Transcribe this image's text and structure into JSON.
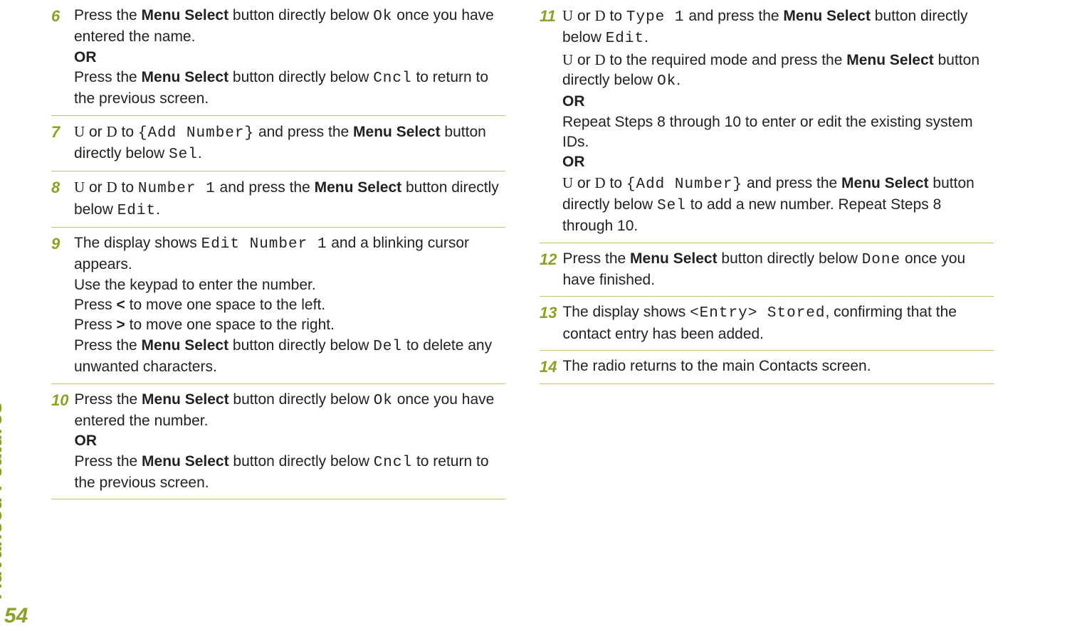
{
  "sidebar": {
    "label": "Advanced Features"
  },
  "page_number": "54",
  "steps": [
    {
      "num": "6",
      "html": "Press the <b>Menu Select</b> button directly below <span class='mono'>Ok</span> once you have entered the name.<br><b>OR</b><br>Press the <b>Menu Select</b> button directly below <span class='mono'>Cncl</span> to return to the previous screen."
    },
    {
      "num": "7",
      "html": "<span class='glyph'>U</span> or <span class='glyph'>D</span> to <span class='mono'>{Add Number}</span> and press the <b>Menu Select</b> button directly below <span class='mono'>Sel</span>."
    },
    {
      "num": "8",
      "html": "<span class='glyph'>U</span> or <span class='glyph'>D</span> to <span class='mono'>Number 1</span> and press the <b>Menu Select</b> button directly below <span class='mono'>Edit</span>."
    },
    {
      "num": "9",
      "html": "The display shows <span class='mono'>Edit Number 1</span> and a blinking cursor appears.<br>Use the keypad to enter the number.<br>Press <span class='lt'>&lt;</span> to move one space to the left.<br>Press <span class='gt'>&gt;</span> to move one space to the right.<br>Press the <b>Menu Select</b> button directly below <span class='mono'>Del</span> to delete any unwanted characters."
    },
    {
      "num": "10",
      "html": "Press the <b>Menu Select</b> button directly below <span class='mono'>Ok</span> once you have entered the number.<br><b>OR</b><br>Press the <b>Menu Select</b> button directly below <span class='mono'>Cncl</span> to return to the previous screen."
    },
    {
      "num": "11",
      "html": "<span class='glyph'>U</span> or <span class='glyph'>D</span> to <span class='mono'>Type 1</span> and press the <b>Menu Select</b> button directly below <span class='mono'>Edit</span>.<br><span class='glyph'>U</span> or <span class='glyph'>D</span> to the required mode and press the <b>Menu Select</b> button directly below <span class='mono'>Ok</span>.<br><b>OR</b><br>Repeat Steps 8 through 10 to enter or edit the existing system IDs.<br><b>OR</b><br><span class='glyph'>U</span> or <span class='glyph'>D</span> to <span class='mono'>{Add Number}</span> and press the <b>Menu Select</b> button directly below <span class='mono'>Sel</span> to add a new number. Repeat Steps 8 through 10."
    },
    {
      "num": "12",
      "html": "Press the <b>Menu Select</b> button directly below <span class='mono'>Done</span> once you have finished."
    },
    {
      "num": "13",
      "html": "The display shows <span class='mono'>&lt;Entry&gt; Stored</span>, confirming that the contact entry has been added."
    },
    {
      "num": "14",
      "html": "The radio returns to the main Contacts screen."
    }
  ]
}
